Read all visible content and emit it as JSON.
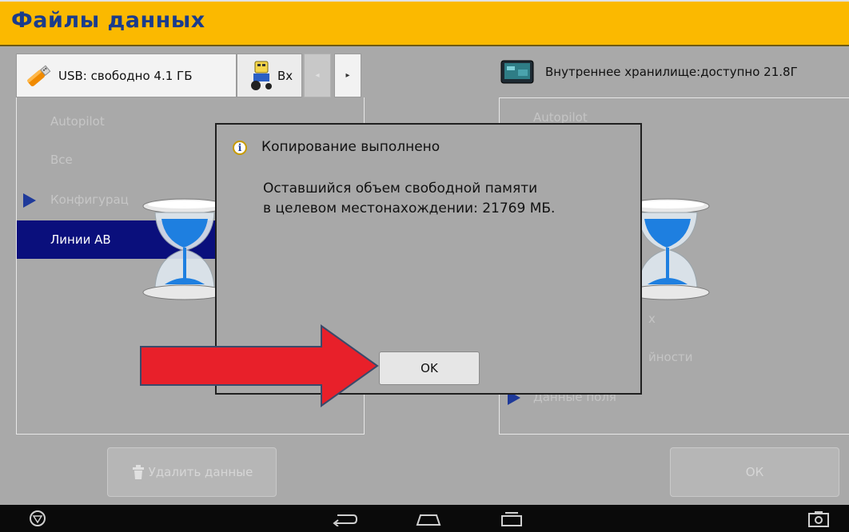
{
  "title": "Файлы данных",
  "tabs": {
    "usb_label": "USB: свободно 4.1 ГБ",
    "tractor_label": "Вх",
    "prev_arrow": "◂",
    "next_arrow": "▸"
  },
  "left_list": {
    "items": [
      "Autopilot",
      "Все",
      "Конфигурац",
      "Линии АВ"
    ],
    "selected": "Линии АВ"
  },
  "storage": {
    "label": "Внутреннее хранилище:доступно 21.8Г"
  },
  "right_list": {
    "item_top": "Autopilot",
    "item_lines_fragment": "х",
    "item_activity_fragment": "йности",
    "item_field": "Данные поля"
  },
  "buttons": {
    "delete_label": "Удалить данные",
    "ok_label": "ОК"
  },
  "dialog": {
    "title": "Копирование выполнено",
    "message": "Оставшийся объем свободной памяти\nв целевом местонахождении: 21769 МБ.",
    "ok_label": "OK"
  },
  "colors": {
    "title_bar": "#fbb900",
    "title_text": "#1a3c8c",
    "selected_row": "#0a0f7c",
    "arrow": "#e8202a"
  },
  "icons": [
    "usb-drive-icon",
    "tractor-icon",
    "display-device-icon",
    "hourglass-icon",
    "info-icon",
    "trash-icon",
    "home-button-icon",
    "back-icon",
    "home-icon",
    "recents-icon",
    "screenshot-icon"
  ]
}
